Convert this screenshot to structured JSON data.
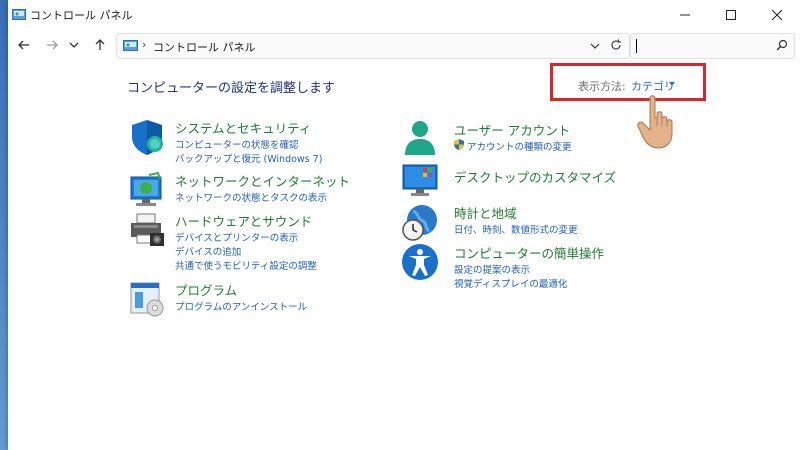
{
  "window": {
    "title": "コントロール パネル",
    "controls": [
      "minimize",
      "maximize",
      "close"
    ]
  },
  "nav": {
    "back_icon": "arrow-left-icon",
    "forward_icon": "arrow-right-icon",
    "recent_icon": "chevron-down-icon",
    "up_icon": "arrow-up-icon"
  },
  "address": {
    "path": "コントロール パネル",
    "sep1": "›",
    "sep2": "›"
  },
  "search": {
    "value": "",
    "icon": "search-icon"
  },
  "main": {
    "title": "コンピューターの設定を調整します",
    "view_by_label": "表示方法:",
    "view_by_value": "カテゴリ"
  },
  "categories_left": [
    {
      "icon": "shield-icon",
      "title": "システムとセキュリティ",
      "links": [
        "コンピューターの状態を確認",
        "バックアップと復元 (Windows 7)"
      ]
    },
    {
      "icon": "network-globe-icon",
      "title": "ネットワークとインターネット",
      "links": [
        "ネットワークの状態とタスクの表示"
      ]
    },
    {
      "icon": "printer-icon",
      "title": "ハードウェアとサウンド",
      "links": [
        "デバイスとプリンターの表示",
        "デバイスの追加",
        "共通で使うモビリティ設定の調整"
      ]
    },
    {
      "icon": "programs-icon",
      "title": "プログラム",
      "links": [
        "プログラムのアンインストール"
      ]
    }
  ],
  "categories_right": [
    {
      "icon": "user-accounts-icon",
      "title": "ユーザー アカウント",
      "links": [
        "アカウントの種類の変更"
      ],
      "link_icon": "uac-shield-icon"
    },
    {
      "icon": "desktop-icon",
      "title": "デスクトップのカスタマイズ",
      "links": []
    },
    {
      "icon": "clock-globe-icon",
      "title": "時計と地域",
      "links": [
        "日付、時刻、数値形式の変更"
      ]
    },
    {
      "icon": "accessibility-icon",
      "title": "コンピューターの簡単操作",
      "links": [
        "設定の提案の表示",
        "視覚ディスプレイの最適化"
      ]
    }
  ],
  "colors": {
    "title_blue": "#1e3287",
    "category_green": "#1b7d32",
    "link_blue": "#1f5fbf",
    "highlight_red": "#d9262c"
  }
}
